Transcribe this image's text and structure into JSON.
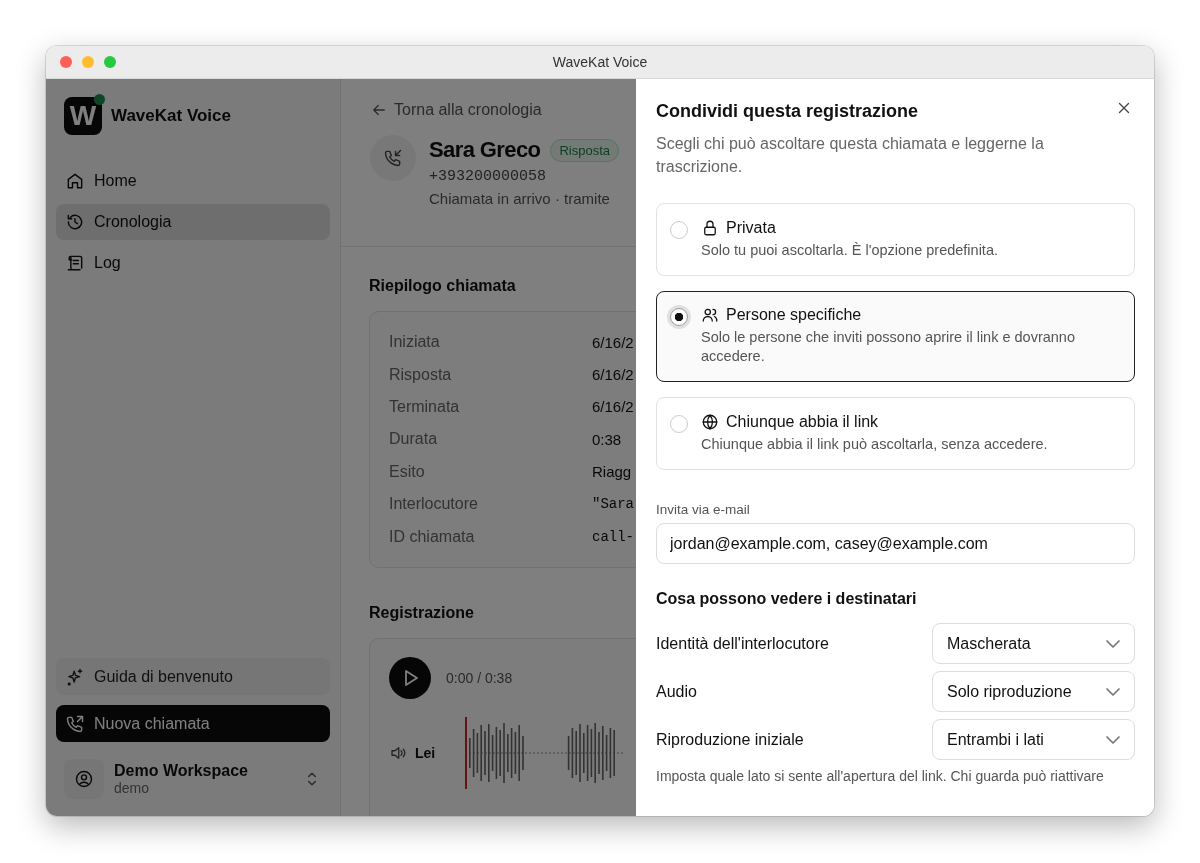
{
  "window": {
    "title": "WaveKat Voice"
  },
  "sidebar": {
    "logo_letter": "W",
    "app_name": "WaveKat Voice",
    "items": [
      {
        "label": "Home",
        "selected": false
      },
      {
        "label": "Cronologia",
        "selected": true
      },
      {
        "label": "Log",
        "selected": false
      }
    ],
    "guide_button": "Guida di benvenuto",
    "new_call_button": "Nuova chiamata",
    "workspace": {
      "name": "Demo Workspace",
      "slug": "demo"
    }
  },
  "call": {
    "back_link": "Torna alla cronologia",
    "name": "Sara Greco",
    "status": "Risposta",
    "number": "+393200000058",
    "subtitle": "Chiamata in arrivo · tramite"
  },
  "summary": {
    "title": "Riepilogo chiamata",
    "rows": [
      {
        "label": "Iniziata",
        "value": "6/16/2",
        "kind": "text"
      },
      {
        "label": "Risposta",
        "value": "6/16/2",
        "kind": "text"
      },
      {
        "label": "Terminata",
        "value": "6/16/2",
        "kind": "text"
      },
      {
        "label": "Durata",
        "value": "0:38",
        "kind": "text"
      },
      {
        "label": "Esito",
        "value": "Riagg",
        "kind": "text"
      },
      {
        "label": "Interlocutore",
        "value": "\"Sara",
        "kind": "mono"
      },
      {
        "label": "ID chiamata",
        "value": "call-",
        "kind": "mono"
      }
    ]
  },
  "recording": {
    "title": "Registrazione",
    "time": "0:00 / 0:38",
    "tracks": [
      {
        "label": "Lei"
      }
    ]
  },
  "share_dialog": {
    "title": "Condividi questa registrazione",
    "description": "Scegli chi può ascoltare questa chiamata e leggerne la trascrizione.",
    "options": [
      {
        "label": "Privata",
        "description": "Solo tu puoi ascoltarla. È l'opzione predefinita.",
        "selected": false
      },
      {
        "label": "Persone specifiche",
        "description": "Solo le persone che inviti possono aprire il link e dovranno accedere.",
        "selected": true
      },
      {
        "label": "Chiunque abbia il link",
        "description": "Chiunque abbia il link può ascoltarla, senza accedere.",
        "selected": false
      }
    ],
    "invite": {
      "label": "Invita via e-mail",
      "value": "jordan@example.com, casey@example.com"
    },
    "visibility": {
      "title": "Cosa possono vedere i destinatari",
      "settings": [
        {
          "label": "Identità dell'interlocutore",
          "value": "Mascherata"
        },
        {
          "label": "Audio",
          "value": "Solo riproduzione"
        },
        {
          "label": "Riproduzione iniziale",
          "value": "Entrambi i lati"
        }
      ],
      "note": "Imposta quale lato si sente all'apertura del link. Chi guarda può riattivare"
    }
  }
}
